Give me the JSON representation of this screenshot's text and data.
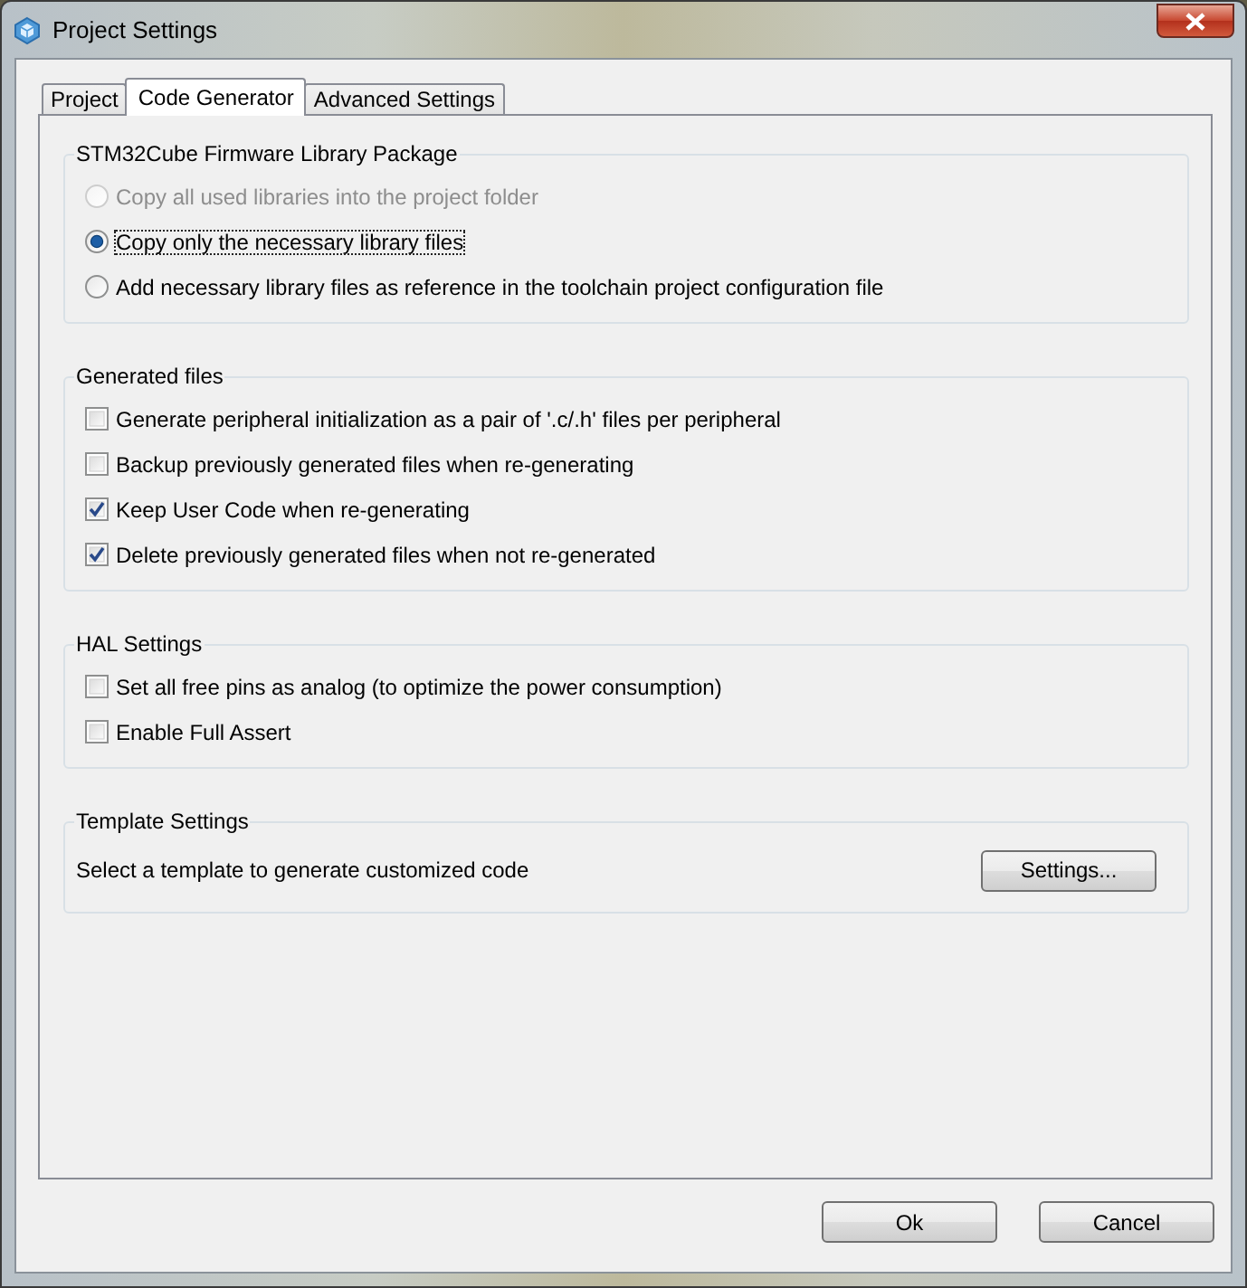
{
  "window": {
    "title": "Project Settings"
  },
  "tabs": [
    {
      "label": "Project",
      "selected": false
    },
    {
      "label": "Code Generator",
      "selected": true
    },
    {
      "label": "Advanced Settings",
      "selected": false
    }
  ],
  "groups": [
    {
      "title": "STM32Cube Firmware Library Package",
      "options": [
        {
          "kind": "radio",
          "label": "Copy all used libraries into the project folder",
          "checked": false,
          "disabled": true,
          "focused": false
        },
        {
          "kind": "radio",
          "label": "Copy only the necessary library files",
          "checked": true,
          "disabled": false,
          "focused": true
        },
        {
          "kind": "radio",
          "label": "Add necessary library files as reference in the toolchain project configuration file",
          "checked": false,
          "disabled": false,
          "focused": false
        }
      ]
    },
    {
      "title": "Generated files",
      "options": [
        {
          "kind": "checkbox",
          "label": "Generate peripheral initialization as a pair of '.c/.h' files per peripheral",
          "checked": false,
          "disabled": false,
          "focused": false
        },
        {
          "kind": "checkbox",
          "label": "Backup previously generated files when re-generating",
          "checked": false,
          "disabled": false,
          "focused": false
        },
        {
          "kind": "checkbox",
          "label": "Keep User Code when re-generating",
          "checked": true,
          "disabled": false,
          "focused": false
        },
        {
          "kind": "checkbox",
          "label": "Delete previously generated files when not re-generated",
          "checked": true,
          "disabled": false,
          "focused": false
        }
      ]
    },
    {
      "title": "HAL Settings",
      "options": [
        {
          "kind": "checkbox",
          "label": "Set all free pins as analog (to optimize the power consumption)",
          "checked": false,
          "disabled": false,
          "focused": false
        },
        {
          "kind": "checkbox",
          "label": "Enable Full Assert",
          "checked": false,
          "disabled": false,
          "focused": false
        }
      ]
    },
    {
      "title": "Template Settings",
      "description": "Select a template to generate customized code",
      "button": "Settings..."
    }
  ],
  "buttons": [
    "Ok",
    "Cancel"
  ]
}
